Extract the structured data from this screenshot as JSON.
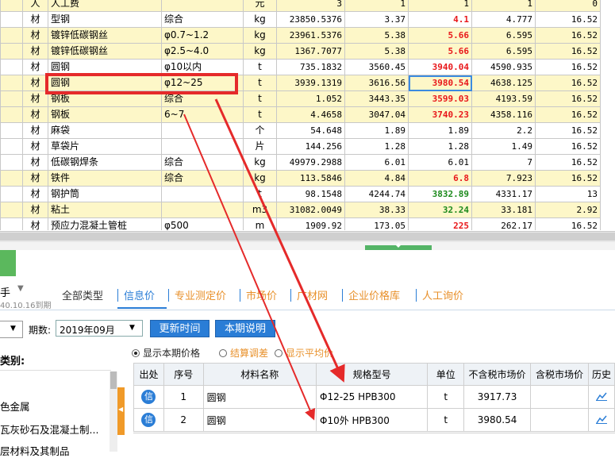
{
  "top_grid": {
    "columns": [
      "",
      "",
      "",
      "",
      "",
      "",
      "",
      "",
      ""
    ],
    "rows": [
      {
        "type": "人",
        "name": "人工费",
        "spec": "",
        "unit": "元",
        "qty": "3",
        "base": "1",
        "price": "1",
        "market": "1",
        "tax": "0",
        "style": "y",
        "price_color": ""
      },
      {
        "type": "材",
        "name": "型钢",
        "spec": "综合",
        "unit": "kg",
        "qty": "23850.5376",
        "base": "3.37",
        "price": "4.1",
        "market": "4.777",
        "tax": "16.52",
        "style": "w",
        "price_color": "red"
      },
      {
        "type": "材",
        "name": "镀锌低碳钢丝",
        "spec": "φ0.7~1.2",
        "unit": "kg",
        "qty": "23961.5376",
        "base": "5.38",
        "price": "5.66",
        "market": "6.595",
        "tax": "16.52",
        "style": "y",
        "price_color": "red"
      },
      {
        "type": "材",
        "name": "镀锌低碳钢丝",
        "spec": "φ2.5~4.0",
        "unit": "kg",
        "qty": "1367.7077",
        "base": "5.38",
        "price": "5.66",
        "market": "6.595",
        "tax": "16.52",
        "style": "y",
        "price_color": "red"
      },
      {
        "type": "材",
        "name": "圆钢",
        "spec": "φ10以内",
        "unit": "t",
        "qty": "735.1832",
        "base": "3560.45",
        "price": "3940.04",
        "market": "4590.935",
        "tax": "16.52",
        "style": "w",
        "price_color": "red"
      },
      {
        "type": "材",
        "name": "圆钢",
        "spec": "φ12~25",
        "unit": "t",
        "qty": "3939.1319",
        "base": "3616.56",
        "price": "3980.54",
        "market": "4638.125",
        "tax": "16.52",
        "style": "sel",
        "price_color": "red"
      },
      {
        "type": "材",
        "name": "钢板",
        "spec": "综合",
        "unit": "t",
        "qty": "1.052",
        "base": "3443.35",
        "price": "3599.03",
        "market": "4193.59",
        "tax": "16.52",
        "style": "y",
        "price_color": "red"
      },
      {
        "type": "材",
        "name": "钢板",
        "spec": "6~7",
        "unit": "t",
        "qty": "4.4658",
        "base": "3047.04",
        "price": "3740.23",
        "market": "4358.116",
        "tax": "16.52",
        "style": "y",
        "price_color": "red"
      },
      {
        "type": "材",
        "name": "麻袋",
        "spec": "",
        "unit": "个",
        "qty": "54.648",
        "base": "1.89",
        "price": "1.89",
        "market": "2.2",
        "tax": "16.52",
        "style": "w",
        "price_color": ""
      },
      {
        "type": "材",
        "name": "草袋片",
        "spec": "",
        "unit": "片",
        "qty": "144.256",
        "base": "1.28",
        "price": "1.28",
        "market": "1.49",
        "tax": "16.52",
        "style": "w",
        "price_color": ""
      },
      {
        "type": "材",
        "name": "低碳钢焊条",
        "spec": "综合",
        "unit": "kg",
        "qty": "49979.2988",
        "base": "6.01",
        "price": "6.01",
        "market": "7",
        "tax": "16.52",
        "style": "w",
        "price_color": ""
      },
      {
        "type": "材",
        "name": "铁件",
        "spec": "综合",
        "unit": "kg",
        "qty": "113.5846",
        "base": "4.84",
        "price": "6.8",
        "market": "7.923",
        "tax": "16.52",
        "style": "y",
        "price_color": "red"
      },
      {
        "type": "材",
        "name": "钢护筒",
        "spec": "",
        "unit": "t",
        "qty": "98.1548",
        "base": "4244.74",
        "price": "3832.89",
        "market": "4331.17",
        "tax": "13",
        "style": "w",
        "price_color": "grn"
      },
      {
        "type": "材",
        "name": "粘土",
        "spec": "",
        "unit": "m3",
        "qty": "31082.0049",
        "base": "38.33",
        "price": "32.24",
        "market": "33.181",
        "tax": "2.92",
        "style": "y",
        "price_color": "grn"
      },
      {
        "type": "材",
        "name": "预应力混凝土管桩",
        "spec": "φ500",
        "unit": "m",
        "qty": "1909.92",
        "base": "173.05",
        "price": "225",
        "market": "262.17",
        "tax": "16.52",
        "style": "w",
        "price_color": "red"
      }
    ]
  },
  "helper": {
    "title": "手",
    "expiry": "40.10.16到期"
  },
  "tabs": [
    {
      "label": "全部类型",
      "style": "gray"
    },
    {
      "label": "信息价",
      "style": "active"
    },
    {
      "label": "专业测定价",
      "style": "orange"
    },
    {
      "label": "市场价",
      "style": "orange"
    },
    {
      "label": "广材网",
      "style": "orange"
    },
    {
      "label": "企业价格库",
      "style": "orange"
    },
    {
      "label": "人工询价",
      "style": "orange"
    }
  ],
  "period": {
    "label": "期数:",
    "value": "2019年09月"
  },
  "buttons": {
    "refresh": "更新时间",
    "explain": "本期说明"
  },
  "category": {
    "label": "类别:",
    "items": [
      "色金属",
      "瓦灰砂石及混凝土制...",
      "层材料及其制品"
    ]
  },
  "radios": [
    {
      "label": "显示本期价格",
      "checked": true,
      "color": "#222"
    },
    {
      "label": "结算调差",
      "checked": false,
      "color": "#e8902a"
    },
    {
      "label": "显示平均价",
      "checked": false,
      "color": "#e8902a"
    }
  ],
  "price_table": {
    "headers": [
      "出处",
      "序号",
      "材料名称",
      "规格型号",
      "单位",
      "不含税市场价",
      "含税市场价",
      "历史"
    ],
    "rows": [
      {
        "source": "信",
        "seq": "1",
        "name": "圆钢",
        "spec": "Φ12-25 HPB300",
        "unit": "t",
        "price": "3917.73",
        "tax_price": ""
      },
      {
        "source": "信",
        "seq": "2",
        "name": "圆钢",
        "spec": "Φ10外 HPB300",
        "unit": "t",
        "price": "3980.54",
        "tax_price": ""
      }
    ]
  },
  "colors": {
    "accent": "#2a7dd6",
    "annotation": "#e52a2a",
    "highlight_row": "#fdf7c8",
    "price_red": "#e8171a",
    "price_green": "#1c8a1c",
    "tab_orange": "#e8902a"
  },
  "icons": [
    "dropdown-arrow-icon",
    "chart-icon",
    "collapse-arrow-icon",
    "splitter-grip-icon"
  ]
}
